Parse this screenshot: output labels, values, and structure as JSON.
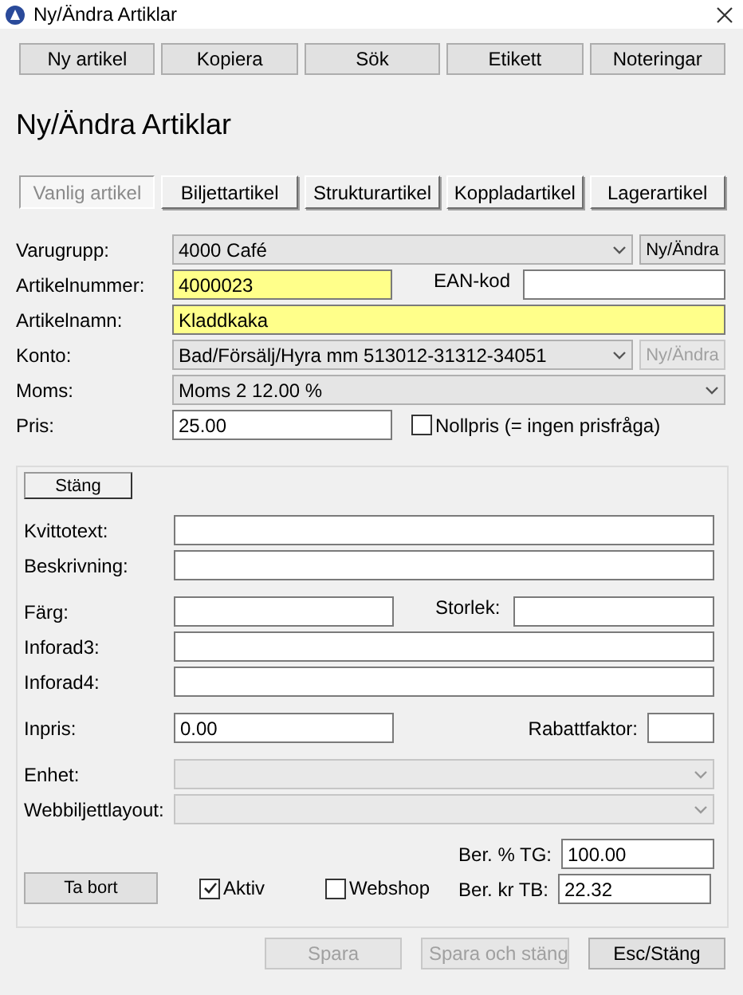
{
  "window": {
    "title": "Ny/Ändra Artiklar"
  },
  "toolbar": [
    {
      "label": "Ny artikel"
    },
    {
      "label": "Kopiera"
    },
    {
      "label": "Sök"
    },
    {
      "label": "Etikett"
    },
    {
      "label": "Noteringar"
    }
  ],
  "heading": "Ny/Ändra Artiklar",
  "tabs": [
    {
      "label": "Vanlig artikel",
      "selected": true
    },
    {
      "label": "Biljettartikel",
      "selected": false
    },
    {
      "label": "Strukturartikel",
      "selected": false
    },
    {
      "label": "Koppladartikel",
      "selected": false
    },
    {
      "label": "Lagerartikel",
      "selected": false
    }
  ],
  "form": {
    "groups": [
      {
        "rows": [
          {
            "kind": "combo",
            "label": "Varugrupp:",
            "value": "4000 Café",
            "disabled": false,
            "button": {
              "label": "Ny/Ändra",
              "disabled": false
            }
          },
          {
            "kind": "pair",
            "label": "Artikelnummer:",
            "value": "4000023",
            "highlighted": true,
            "label2": "EAN-kod"
          },
          {
            "kind": "text",
            "label": "Artikelnamn:",
            "value": "Kladdkaka",
            "highlighted": true
          },
          {
            "kind": "combo",
            "label": "Konto:",
            "value": "Bad/Försälj/Hyra mm 513012-31312-34051",
            "disabled": false,
            "button": {
              "label": "Ny/Ändra",
              "disabled": true
            }
          },
          {
            "kind": "combo",
            "label": "Moms:",
            "value": "Moms 2 12.00 %",
            "disabled": false
          },
          {
            "kind": "check",
            "label": "Pris:",
            "value": "25.00",
            "highlighted": false,
            "checkbox": {
              "label": "Nollpris (= ingen prisfråga)",
              "checked": false
            }
          }
        ]
      }
    ]
  },
  "panel": {
    "close_button": "Stäng",
    "groups": [
      {
        "rows": [
          {
            "kind": "text",
            "label": "Kvittotext:",
            "highlighted": false
          },
          {
            "kind": "text",
            "label": "Beskrivning:",
            "highlighted": false
          }
        ]
      },
      {
        "rows": [
          {
            "kind": "pair",
            "label": "Färg:",
            "highlighted": false,
            "label2": "Storlek:"
          },
          {
            "kind": "text",
            "label": "Inforad3:",
            "highlighted": false
          },
          {
            "kind": "text",
            "label": "Inforad4:",
            "highlighted": false
          }
        ]
      },
      {
        "rows": [
          {
            "kind": "pair-narrow",
            "label": "Inpris:",
            "value": "0.00",
            "highlighted": false,
            "label2": "Rabattfaktor:"
          }
        ]
      },
      {
        "rows": [
          {
            "kind": "combo",
            "label": "Enhet:",
            "disabled": true
          },
          {
            "kind": "combo",
            "label": "Webbiljettlayout:",
            "disabled": true
          }
        ]
      }
    ],
    "delete_button": "Ta bort",
    "checkboxes": [
      {
        "label": "Aktiv",
        "checked": true
      },
      {
        "label": "Webshop",
        "checked": false
      }
    ],
    "results": [
      {
        "label": "Ber. % TG:",
        "value": "100.00"
      },
      {
        "label": "Ber. kr TB:",
        "value": "22.32"
      }
    ]
  },
  "footer": [
    {
      "label": "Spara",
      "disabled": true
    },
    {
      "label": "Spara och stäng",
      "disabled": true
    },
    {
      "label": "Esc/Stäng",
      "disabled": false
    }
  ]
}
